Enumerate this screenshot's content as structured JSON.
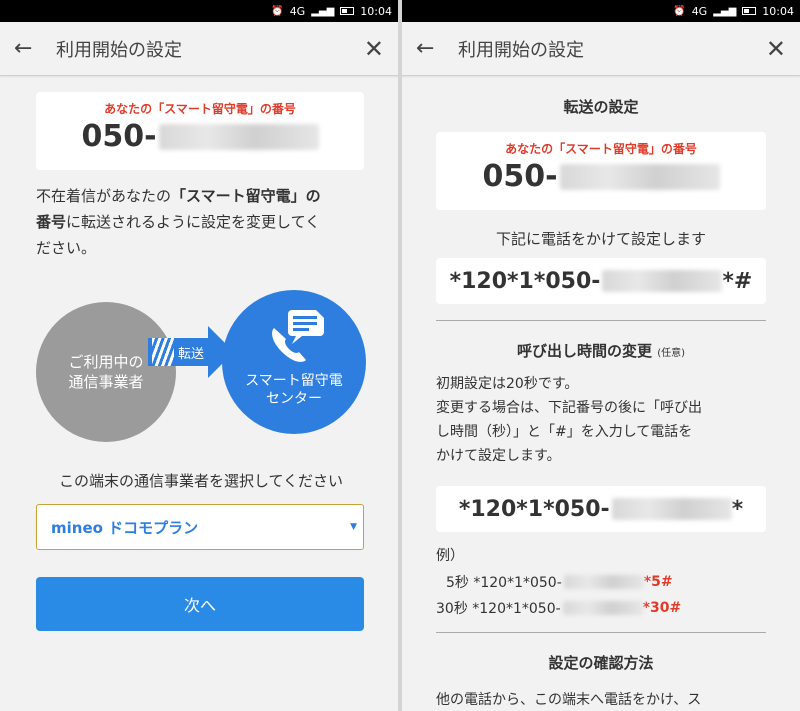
{
  "status": {
    "network": "4G",
    "time": "10:04"
  },
  "left": {
    "title": "利用開始の設定",
    "number_label": "あなたの「スマート留守電」の番号",
    "number_prefix": "050-",
    "desc_1": "不在着信があなたの",
    "desc_bold_1": "「スマート留守電」の",
    "desc_bold_2": "番号",
    "desc_2": "に転送されるように設定を変更してく",
    "desc_3": "ださい。",
    "graphic": {
      "gray_line1": "ご利用中の",
      "gray_line2": "通信事業者",
      "arrow_label": "転送",
      "blue_line1": "スマート留守電",
      "blue_line2": "センター"
    },
    "select_prompt": "この端末の通信事業者を選択してください",
    "select_value": "mineo ドコモプラン",
    "next_label": "次へ"
  },
  "right": {
    "title": "利用開始の設定",
    "section_forward": "転送の設定",
    "number_label": "あなたの「スマート留守電」の番号",
    "number_prefix": "050-",
    "call_instruction": "下記に電話をかけて設定します",
    "code1_prefix": "*120*1*050-",
    "code1_suffix": "*#",
    "section_ring": "呼び出し時間の変更",
    "section_ring_note": "(任意)",
    "ring_line1": "初期設定は20秒です。",
    "ring_line2": "変更する場合は、下記番号の後に「呼び出",
    "ring_line3": "し時間（秒）」と「#」を入力して電話を",
    "ring_line4": "かけて設定します。",
    "code2_prefix": "*120*1*050-",
    "code2_suffix": "*",
    "example_label": "例）",
    "ex1_label": "5秒 *120*1*050-",
    "ex1_suffix": "*5#",
    "ex2_label": "30秒 *120*1*050-",
    "ex2_suffix": "*30#",
    "section_confirm": "設定の確認方法",
    "confirm_text": "他の電話から、この端末へ電話をかけ、ス"
  },
  "colors": {
    "accent_blue": "#2a8be7",
    "accent_red": "#e03c2b",
    "gray_circle": "#9b9b9b"
  },
  "icons": [
    "back-arrow-icon",
    "close-icon",
    "phone-chat-icon",
    "alarm-icon",
    "signal-icon",
    "battery-icon"
  ]
}
